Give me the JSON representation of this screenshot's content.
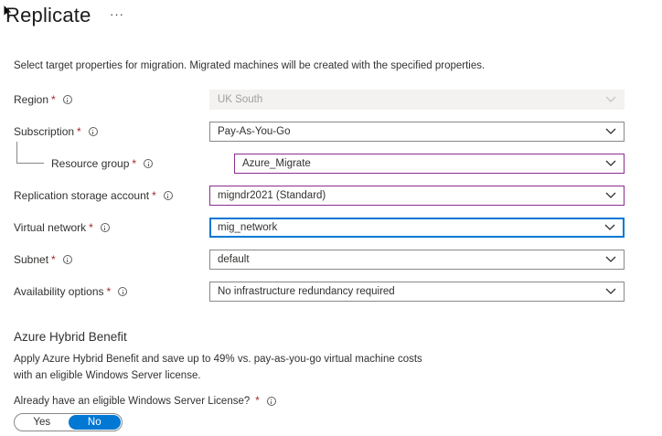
{
  "header": {
    "title": "Replicate",
    "more_label": "···"
  },
  "description": "Select target properties for migration. Migrated machines will be created with the specified properties.",
  "fields": {
    "region": {
      "label": "Region",
      "value": "UK South"
    },
    "subscription": {
      "label": "Subscription",
      "value": "Pay-As-You-Go"
    },
    "resource_group": {
      "label": "Resource group",
      "value": "Azure_Migrate"
    },
    "storage_account": {
      "label": "Replication storage account",
      "value": "migndr2021 (Standard)"
    },
    "virtual_network": {
      "label": "Virtual network",
      "value": "mig_network"
    },
    "subnet": {
      "label": "Subnet",
      "value": "default"
    },
    "availability": {
      "label": "Availability options",
      "value": "No infrastructure redundancy required"
    }
  },
  "required_mark": "*",
  "hybrid": {
    "title": "Azure Hybrid Benefit",
    "desc_line1": "Apply Azure Hybrid Benefit and save up to 49% vs. pay-as-you-go virtual machine costs",
    "desc_line2": "with an eligible Windows Server license.",
    "question": "Already have an eligible Windows Server License?",
    "yes_label": "Yes",
    "no_label": "No",
    "selected": "No"
  },
  "colors": {
    "accent": "#0078d4",
    "required": "#a4262c",
    "validation_border": "#8a2d8e"
  }
}
